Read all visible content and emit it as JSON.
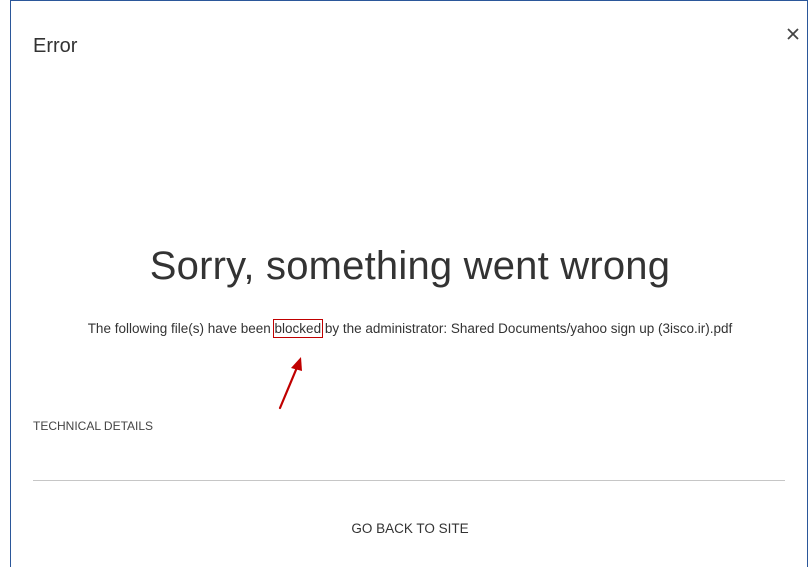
{
  "dialog": {
    "title": "Error",
    "close_icon": "close-icon"
  },
  "error": {
    "headline": "Sorry, something went wrong",
    "message_before": "The following file(s) have been ",
    "message_highlight": "blocked",
    "message_after": " by the administrator: Shared Documents/yahoo sign up (3isco.ir).pdf"
  },
  "technical_details_label": "TECHNICAL DETAILS",
  "go_back_label": "GO BACK TO SITE",
  "colors": {
    "border": "#2b579a",
    "annotation": "#c00000",
    "text": "#333333"
  }
}
